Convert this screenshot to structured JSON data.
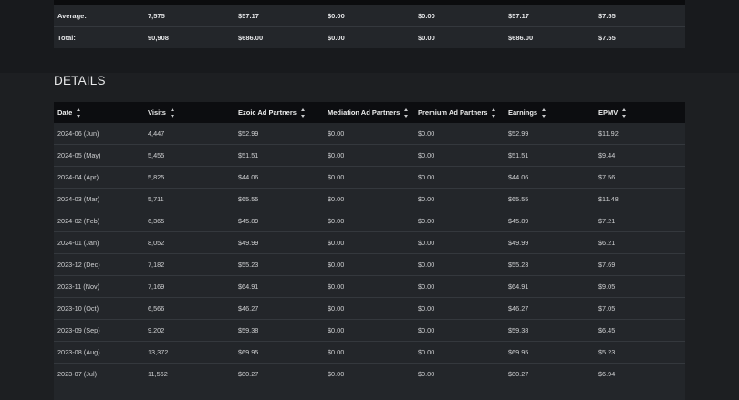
{
  "summary": {
    "rows": [
      [
        "Average:",
        "7,575",
        "$57.17",
        "$0.00",
        "$0.00",
        "$57.17",
        "$7.55"
      ],
      [
        "Total:",
        "90,908",
        "$686.00",
        "$0.00",
        "$0.00",
        "$686.00",
        "$7.55"
      ]
    ]
  },
  "details": {
    "title": "DETAILS",
    "headers": [
      "Date",
      "Visits",
      "Ezoic Ad Partners",
      "Mediation Ad Partners",
      "Premium Ad Partners",
      "Earnings",
      "EPMV"
    ],
    "rows": [
      [
        "2024-06 (Jun)",
        "4,447",
        "$52.99",
        "$0.00",
        "$0.00",
        "$52.99",
        "$11.92"
      ],
      [
        "2024-05 (May)",
        "5,455",
        "$51.51",
        "$0.00",
        "$0.00",
        "$51.51",
        "$9.44"
      ],
      [
        "2024-04 (Apr)",
        "5,825",
        "$44.06",
        "$0.00",
        "$0.00",
        "$44.06",
        "$7.56"
      ],
      [
        "2024-03 (Mar)",
        "5,711",
        "$65.55",
        "$0.00",
        "$0.00",
        "$65.55",
        "$11.48"
      ],
      [
        "2024-02 (Feb)",
        "6,365",
        "$45.89",
        "$0.00",
        "$0.00",
        "$45.89",
        "$7.21"
      ],
      [
        "2024-01 (Jan)",
        "8,052",
        "$49.99",
        "$0.00",
        "$0.00",
        "$49.99",
        "$6.21"
      ],
      [
        "2023-12 (Dec)",
        "7,182",
        "$55.23",
        "$0.00",
        "$0.00",
        "$55.23",
        "$7.69"
      ],
      [
        "2023-11 (Nov)",
        "7,169",
        "$64.91",
        "$0.00",
        "$0.00",
        "$64.91",
        "$9.05"
      ],
      [
        "2023-10 (Oct)",
        "6,566",
        "$46.27",
        "$0.00",
        "$0.00",
        "$46.27",
        "$7.05"
      ],
      [
        "2023-09 (Sep)",
        "9,202",
        "$59.38",
        "$0.00",
        "$0.00",
        "$59.38",
        "$6.45"
      ],
      [
        "2023-08 (Aug)",
        "13,372",
        "$69.95",
        "$0.00",
        "$0.00",
        "$69.95",
        "$5.23"
      ],
      [
        "2023-07 (Jul)",
        "11,562",
        "$80.27",
        "$0.00",
        "$0.00",
        "$80.27",
        "$6.94"
      ]
    ]
  }
}
